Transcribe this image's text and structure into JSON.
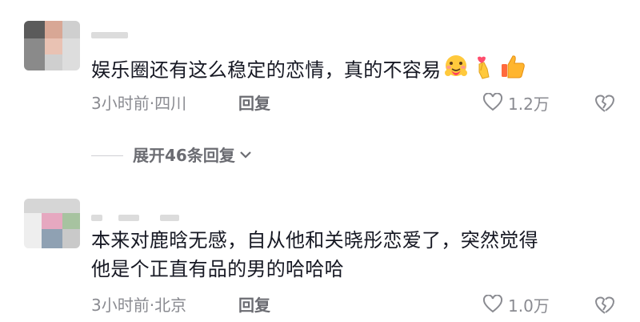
{
  "comments": [
    {
      "text": "娱乐圈还有这么稳定的恋情，真的不容易",
      "time_location": "3小时前·四川",
      "reply_label": "回复",
      "like_count": "1.2万",
      "emojis": [
        "hugging-face-emoji",
        "crossed-fingers-heart-emoji",
        "thumbs-up-emoji"
      ]
    },
    {
      "text_line1": "本来对鹿晗无感，自从他和关晓彤恋爱了，突然觉得",
      "text_line2": "他是个正直有品的男的哈哈哈",
      "time_location": "3小时前·北京",
      "reply_label": "回复",
      "like_count": "1.0万"
    }
  ],
  "expand_replies_label": "展开46条回复",
  "colors": {
    "text": "#161823",
    "meta": "#8a8b91",
    "action": "#6b6c72"
  }
}
